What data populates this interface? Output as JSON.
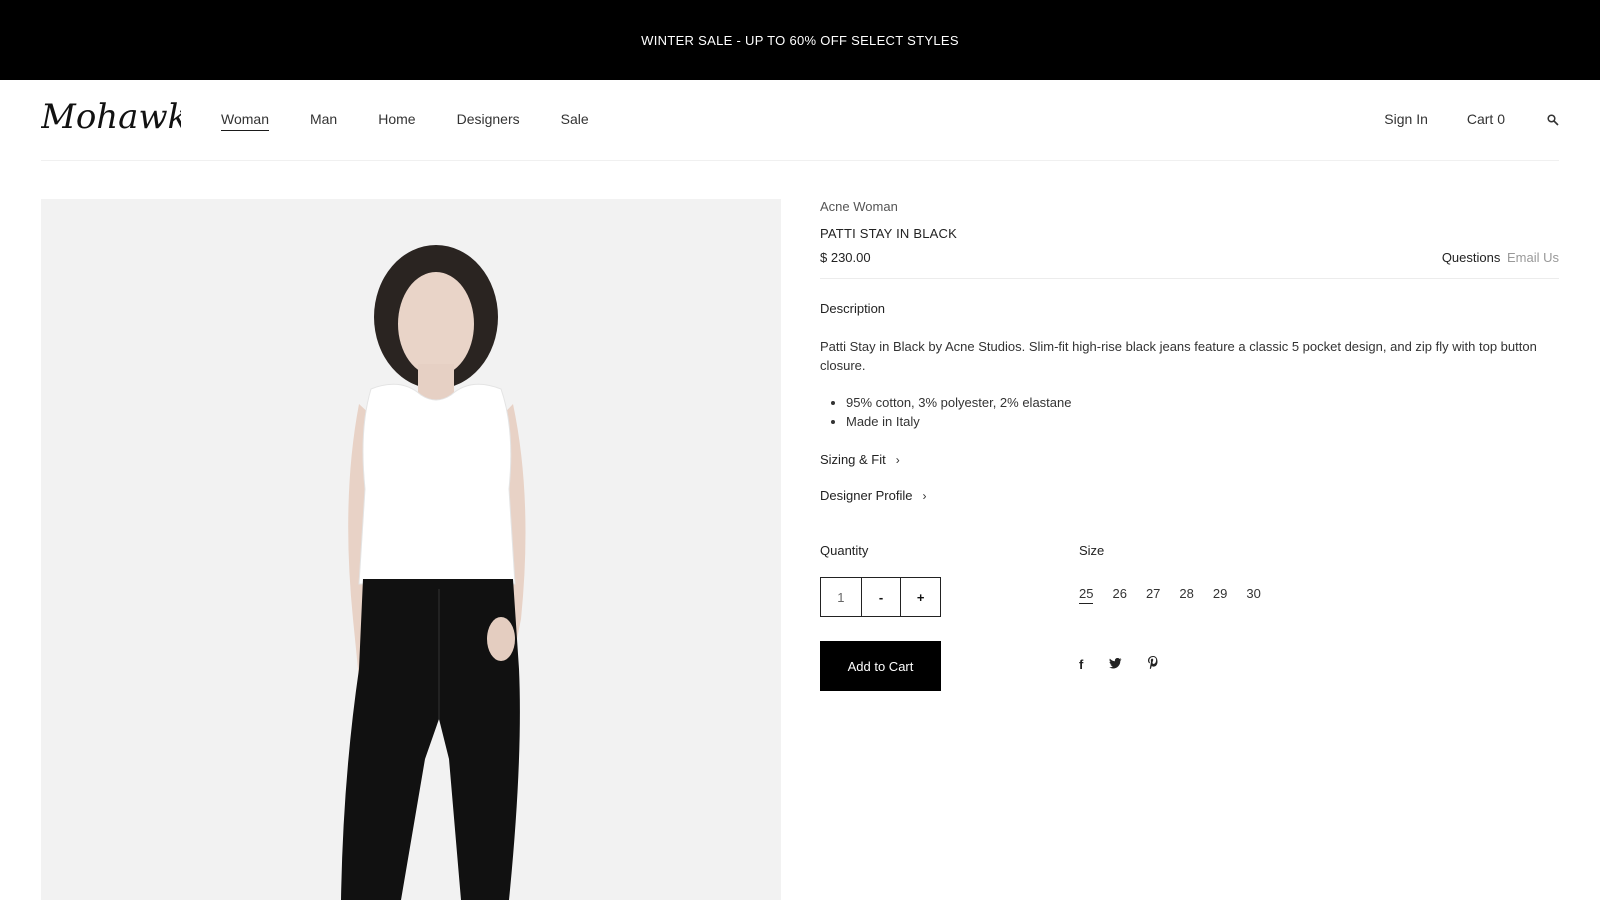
{
  "banner": {
    "text": "WINTER SALE - UP TO 60% OFF SELECT STYLES"
  },
  "header": {
    "logo_text": "Mohawk",
    "nav": [
      {
        "label": "Woman",
        "active": true
      },
      {
        "label": "Man",
        "active": false
      },
      {
        "label": "Home",
        "active": false
      },
      {
        "label": "Designers",
        "active": false
      },
      {
        "label": "Sale",
        "active": false
      }
    ],
    "sign_in": "Sign In",
    "cart": "Cart 0",
    "search_icon": "search-icon"
  },
  "product": {
    "brand": "Acne Woman",
    "title": "PATTI STAY IN BLACK",
    "price": "$ 230.00",
    "questions_label": "Questions",
    "email_link": "Email Us",
    "description_heading": "Description",
    "description": "Patti Stay in Black by Acne Studios. Slim-fit high-rise black jeans feature a classic 5 pocket design, and zip fly with top button closure.",
    "details": [
      "95% cotton, 3% polyester, 2% elastane",
      "Made in Italy"
    ],
    "sizing_link": "Sizing & Fit",
    "designer_link": "Designer Profile",
    "quantity_label": "Quantity",
    "quantity_value": "1",
    "minus": "-",
    "plus": "+",
    "size_label": "Size",
    "sizes": [
      "25",
      "26",
      "27",
      "28",
      "29",
      "30"
    ],
    "selected_size": "25",
    "add_to_cart": "Add to Cart",
    "social": [
      "f",
      "twitter-icon",
      "pinterest-icon"
    ]
  },
  "colors": {
    "banner_bg": "#000000",
    "accent": "#000000",
    "muted_link": "#999999"
  }
}
